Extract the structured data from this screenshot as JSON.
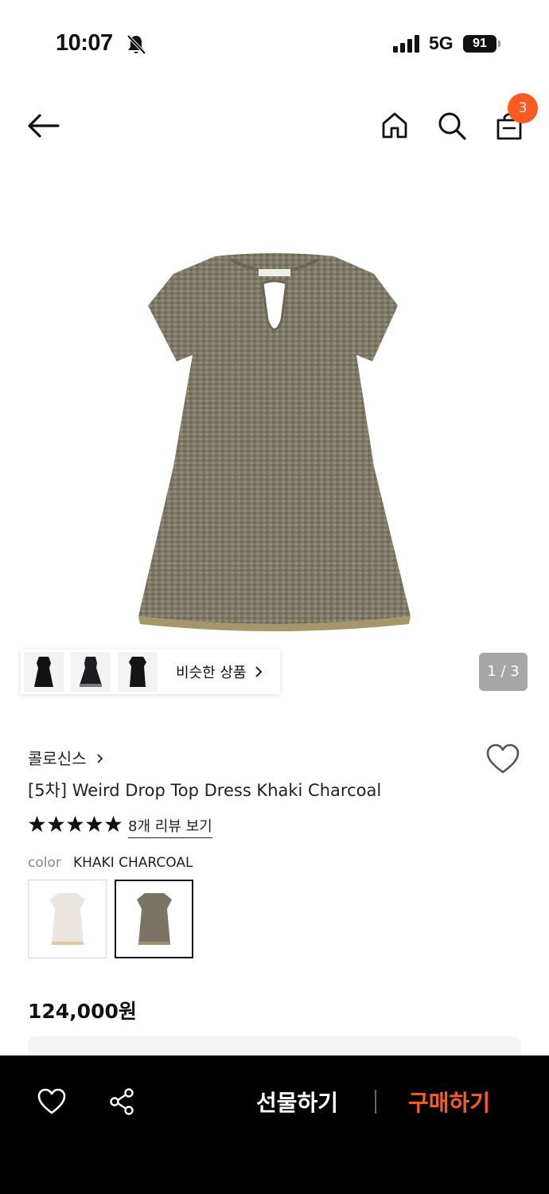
{
  "status_bar": {
    "time": "10:07",
    "network": "5G",
    "battery": "91"
  },
  "header": {
    "cart_count": "3"
  },
  "gallery": {
    "similar_label": "비슷한 상품",
    "page_indicator": "1 / 3"
  },
  "product": {
    "brand": "콜로신스",
    "title": "[5차] Weird Drop Top Dress Khaki Charcoal",
    "rating_stars": 5,
    "review_link": "8개 리뷰 보기",
    "color_label": "color",
    "color_value": "KHAKI CHARCOAL",
    "price": "124,000원"
  },
  "bottom_bar": {
    "gift_label": "선물하기",
    "buy_label": "구매하기"
  },
  "colors": {
    "accent": "#ff5a1f",
    "bottom_bar": "#000000",
    "page_indicator": "#a6a6a6"
  },
  "icons": [
    "bell-slash-icon",
    "signal-icon",
    "back-arrow-icon",
    "home-icon",
    "search-icon",
    "shopping-bag-icon",
    "chevron-right-icon",
    "heart-icon",
    "star-icon",
    "share-icon"
  ]
}
